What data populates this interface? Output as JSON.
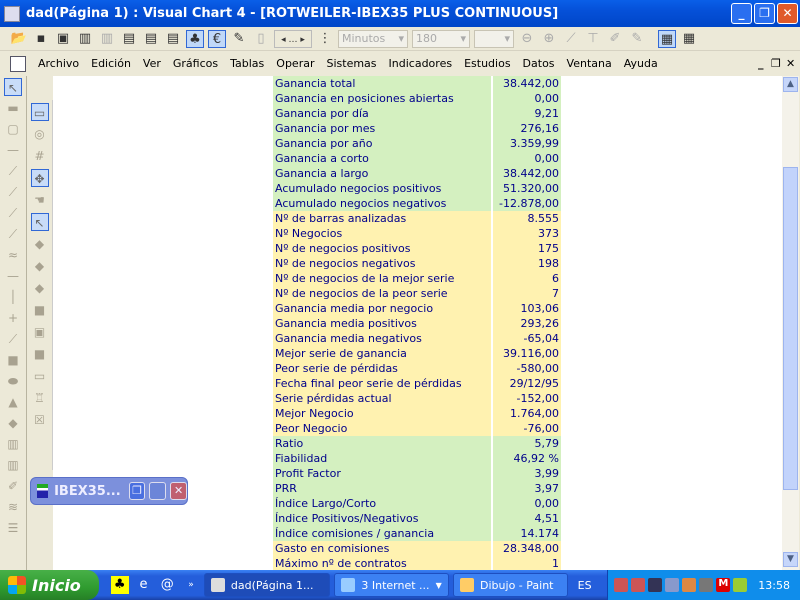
{
  "window": {
    "title": "dad(Página 1) : Visual Chart 4 - [ROTWEILER-IBEX35 PLUS CONTINUOUS]"
  },
  "toolbar": {
    "interval_combo": "Minutos",
    "period_combo": "180",
    "third_combo": ""
  },
  "menu": [
    "Archivo",
    "Edición",
    "Ver",
    "Gráficos",
    "Tablas",
    "Operar",
    "Sistemas",
    "Indicadores",
    "Estudios",
    "Datos",
    "Ventana",
    "Ayuda"
  ],
  "stats": [
    {
      "label": "Ganancia total",
      "value": "38.442,00",
      "group": "g"
    },
    {
      "label": "Ganancia en posiciones abiertas",
      "value": "0,00",
      "group": "g"
    },
    {
      "label": "Ganancia por día",
      "value": "9,21",
      "group": "g"
    },
    {
      "label": "Ganancia por mes",
      "value": "276,16",
      "group": "g"
    },
    {
      "label": "Ganancia por año",
      "value": "3.359,99",
      "group": "g"
    },
    {
      "label": "Ganancia a corto",
      "value": "0,00",
      "group": "g"
    },
    {
      "label": "Ganancia a largo",
      "value": "38.442,00",
      "group": "g"
    },
    {
      "label": "Acumulado negocios positivos",
      "value": "51.320,00",
      "group": "g"
    },
    {
      "label": "Acumulado negocios negativos",
      "value": "-12.878,00",
      "group": "g"
    },
    {
      "label": "Nº de barras analizadas",
      "value": "8.555",
      "group": "y"
    },
    {
      "label": "Nº Negocios",
      "value": "373",
      "group": "y"
    },
    {
      "label": "Nº de negocios positivos",
      "value": "175",
      "group": "y"
    },
    {
      "label": "Nº de negocios negativos",
      "value": "198",
      "group": "y"
    },
    {
      "label": "Nº de negocios de la mejor serie",
      "value": "6",
      "group": "y"
    },
    {
      "label": "Nº de negocios de la peor serie",
      "value": "7",
      "group": "y"
    },
    {
      "label": "Ganancia media por negocio",
      "value": "103,06",
      "group": "y"
    },
    {
      "label": "Ganancia media positivos",
      "value": "293,26",
      "group": "y"
    },
    {
      "label": "Ganancia media negativos",
      "value": "-65,04",
      "group": "y"
    },
    {
      "label": "Mejor serie de ganancia",
      "value": "39.116,00",
      "group": "y"
    },
    {
      "label": "Peor serie de pérdidas",
      "value": "-580,00",
      "group": "y"
    },
    {
      "label": "Fecha final peor serie de pérdidas",
      "value": "29/12/95",
      "group": "y"
    },
    {
      "label": "Serie pérdidas actual",
      "value": "-152,00",
      "group": "y"
    },
    {
      "label": "Mejor Negocio",
      "value": "1.764,00",
      "group": "y"
    },
    {
      "label": "Peor Negocio",
      "value": "-76,00",
      "group": "y"
    },
    {
      "label": "Ratio",
      "value": "5,79",
      "group": "g"
    },
    {
      "label": "Fiabilidad",
      "value": "46,92 %",
      "group": "g"
    },
    {
      "label": "Profit Factor",
      "value": "3,99",
      "group": "g"
    },
    {
      "label": "PRR",
      "value": "3,97",
      "group": "g"
    },
    {
      "label": "Índice Largo/Corto",
      "value": "0,00",
      "group": "g"
    },
    {
      "label": "Índice Positivos/Negativos",
      "value": "4,51",
      "group": "g"
    },
    {
      "label": "Índice comisiones / ganancia",
      "value": "14.174",
      "group": "g"
    },
    {
      "label": "Gasto en comisiones",
      "value": "28.348,00",
      "group": "y"
    },
    {
      "label": "Máximo nº de contratos",
      "value": "1",
      "group": "y"
    }
  ],
  "minimized_window": {
    "title": "IBEX35..."
  },
  "taskbar": {
    "start": "Inicio",
    "tasks": [
      {
        "label": "dad(Página 1...",
        "active": true
      },
      {
        "label": "3 Internet ...",
        "active": false
      },
      {
        "label": "Dibujo - Paint",
        "active": false
      }
    ],
    "language": "ES",
    "clock": "13:58"
  },
  "colors": {
    "green_row": "#d4f0c0",
    "yellow_row": "#fff2b0",
    "text": "#00008b",
    "titlebar": "#0550d8"
  }
}
